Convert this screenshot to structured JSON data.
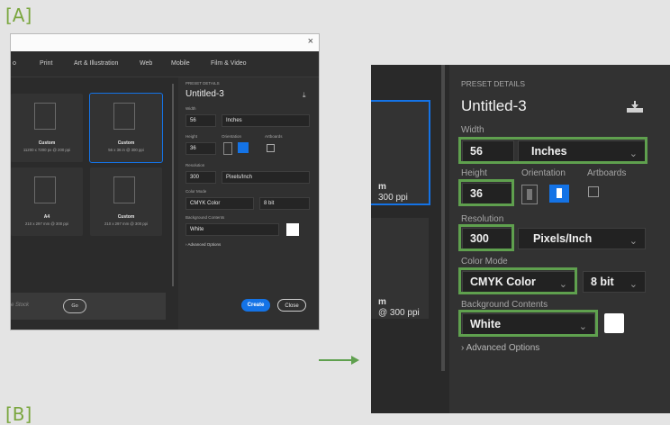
{
  "labels": {
    "a": "[A]",
    "b": "[B]"
  },
  "thumb": {
    "close_glyph": "×",
    "tabs": [
      "o",
      "Print",
      "Art & Illustration",
      "Web",
      "Mobile",
      "Film & Video"
    ],
    "cards": [
      {
        "title": "Custom",
        "sub": "11200 x 7200 px @ 200 ppi"
      },
      {
        "title": "Custom",
        "sub": "56 x 36 in @ 300 ppi"
      },
      {
        "title": "A4",
        "sub": "210 x 297 mm @ 300 ppi"
      },
      {
        "title": "Custom",
        "sub": "210 x 297 mm @ 300 ppi"
      }
    ],
    "search_placeholder": "e Stock",
    "go_label": "Go",
    "preset_details": "PRESET DETAILS",
    "doc_name": "Untitled-3",
    "width_label": "Width",
    "width_value": "56",
    "width_unit": "Inches",
    "height_label": "Height",
    "height_value": "36",
    "orientation_label": "Orientation",
    "artboards_label": "Artboards",
    "resolution_label": "Resolution",
    "resolution_value": "300",
    "resolution_unit": "Pixels/Inch",
    "color_mode_label": "Color Mode",
    "color_mode_value": "CMYK Color",
    "bit_depth": "8 bit",
    "bg_label": "Background Contents",
    "bg_value": "White",
    "advanced": "Advanced Options",
    "create_label": "Create",
    "close_label": "Close"
  },
  "zoom": {
    "partial_card_1": {
      "line1": "m",
      "line2": "300 ppi"
    },
    "partial_card_2": {
      "line1": "m",
      "line2": "@ 300 ppi"
    },
    "preset_details": "PRESET DETAILS",
    "doc_name": "Untitled-3",
    "width_label": "Width",
    "width_value": "56",
    "width_unit": "Inches",
    "height_label": "Height",
    "height_value": "36",
    "orientation_label": "Orientation",
    "artboards_label": "Artboards",
    "resolution_label": "Resolution",
    "resolution_value": "300",
    "resolution_unit": "Pixels/Inch",
    "color_mode_label": "Color Mode",
    "color_mode_value": "CMYK Color",
    "bit_depth": "8 bit",
    "bg_label": "Background Contents",
    "bg_value": "White",
    "advanced": "Advanced Options"
  },
  "colors": {
    "highlight": "#5fa04e",
    "accent_blue": "#1473e6",
    "label_green": "#7aa63e"
  }
}
